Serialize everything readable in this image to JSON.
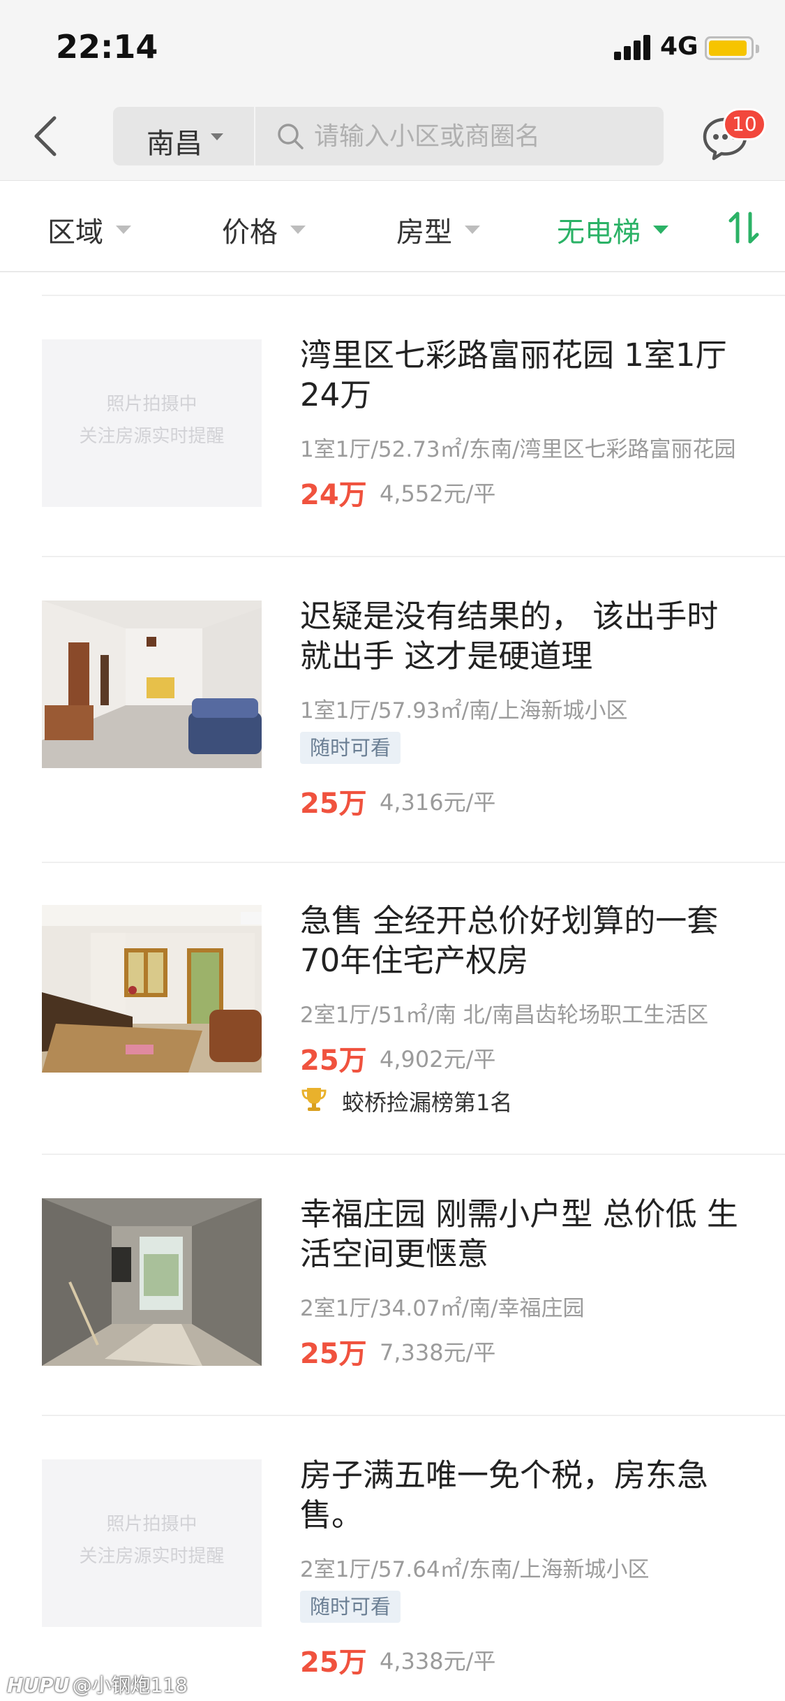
{
  "status_bar": {
    "time": "22:14",
    "network": "4G"
  },
  "nav": {
    "city": "南昌",
    "search_placeholder": "请输入小区或商圈名",
    "message_badge": "10"
  },
  "filters": [
    {
      "label": "区域",
      "active": false
    },
    {
      "label": "价格",
      "active": false
    },
    {
      "label": "房型",
      "active": false
    },
    {
      "label": "无电梯",
      "active": true
    }
  ],
  "colors": {
    "accent": "#2bb266",
    "price": "#f0523e",
    "badge": "#f2473c"
  },
  "listings": [
    {
      "title": "湾里区七彩路富丽花园 1室1厅 24万",
      "meta": "1室1厅/52.73㎡/东南/湾里区七彩路富丽花园",
      "price": "24万",
      "unit_price": "4,552元/平",
      "image": {
        "placeholder": true,
        "line1": "照片拍摄中",
        "line2": "关注房源实时提醒"
      }
    },
    {
      "title": "迟疑是没有结果的， 该出手时就出手  这才是硬道理",
      "meta": "1室1厅/57.93㎡/南/上海新城小区",
      "tag": "随时可看",
      "price": "25万",
      "unit_price": "4,316元/平",
      "image": {
        "placeholder": false,
        "scene": "living-room-sofa"
      }
    },
    {
      "title": "急售  全经开总价好划算的一套70年住宅产权房",
      "meta": "2室1厅/51㎡/南 北/南昌齿轮场职工生活区",
      "price": "25万",
      "unit_price": "4,902元/平",
      "rank": "蛟桥捡漏榜第1名",
      "image": {
        "placeholder": false,
        "scene": "bedroom-windows"
      }
    },
    {
      "title": "幸福庄园 刚需小户型 总价低 生活空间更惬意",
      "meta": "2室1厅/34.07㎡/南/幸福庄园",
      "price": "25万",
      "unit_price": "7,338元/平",
      "image": {
        "placeholder": false,
        "scene": "bare-concrete-room"
      }
    },
    {
      "title": "房子满五唯一免个税，房东急售。",
      "meta": "2室1厅/57.64㎡/东南/上海新城小区",
      "tag": "随时可看",
      "price": "25万",
      "unit_price": "4,338元/平",
      "image": {
        "placeholder": true,
        "line1": "照片拍摄中",
        "line2": "关注房源实时提醒"
      }
    }
  ],
  "watermark": {
    "brand": "HUPU",
    "user": "@小钢炮118"
  }
}
